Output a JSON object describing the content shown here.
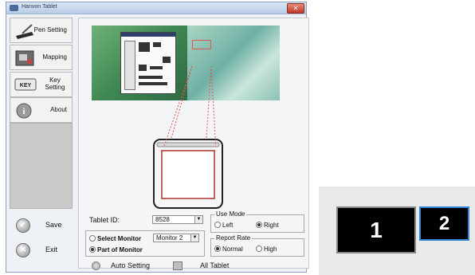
{
  "window": {
    "title": "Hanvon Tablet"
  },
  "sidebar": {
    "items": [
      {
        "label": "Pen Setting",
        "icon": "pen-tablet-icon"
      },
      {
        "label": "Mapping",
        "icon": "mapping-icon"
      },
      {
        "label": "Key Setting",
        "icon": "keyboard-icon",
        "key_text": "KEY"
      },
      {
        "label": "About",
        "icon": "info-icon"
      }
    ]
  },
  "actions": {
    "save_label": "Save",
    "exit_label": "Exit",
    "auto_setting_label": "Auto Setting",
    "all_tablet_label": "All Tablet"
  },
  "form": {
    "tablet_id_label": "Tablet ID:",
    "tablet_id_value": "8528",
    "select_monitor_label": "Select Monitor",
    "monitor_value": "Monitor 2",
    "part_of_monitor_label": "Part of Monitor",
    "use_mode": {
      "legend": "Use Mode",
      "options": [
        "Left",
        "Right"
      ],
      "selected": "Right"
    },
    "report_rate": {
      "legend": "Report Rate",
      "options": [
        "Normal",
        "High"
      ],
      "selected": "Normal"
    }
  },
  "monitor_boxes": [
    "1",
    "2"
  ],
  "colors": {
    "accent_blue": "#2f86d8",
    "mapping_red": "#e25555"
  }
}
